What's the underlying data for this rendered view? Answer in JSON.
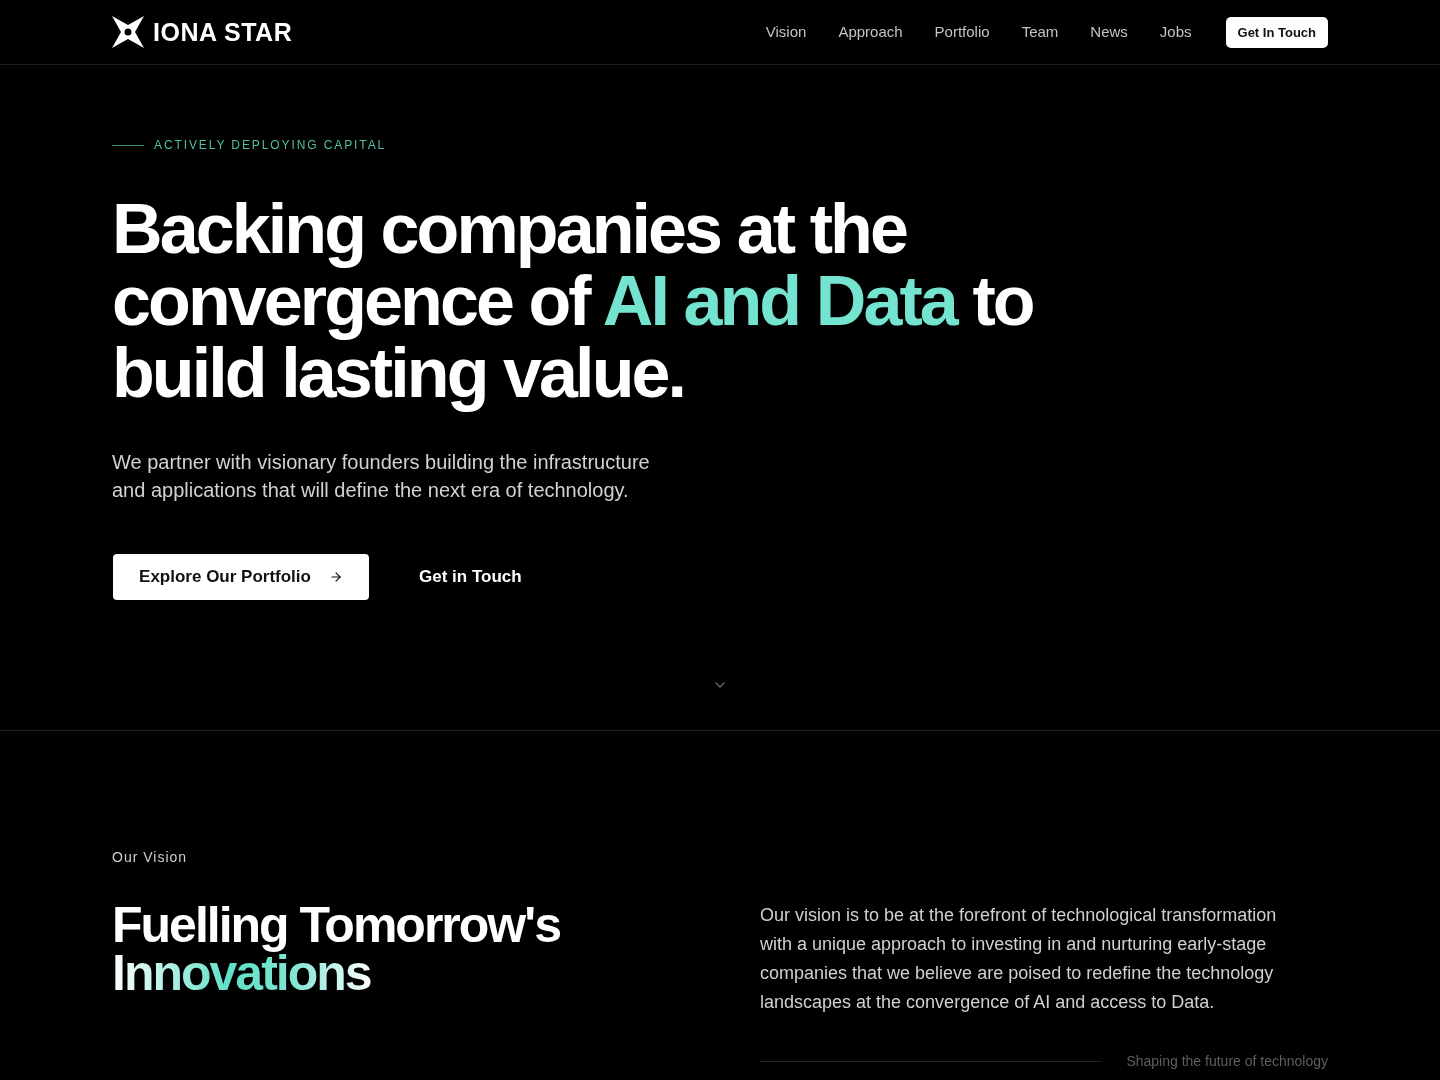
{
  "header": {
    "logo": "IONA STAR",
    "nav_links": [
      "Vision",
      "Approach",
      "Portfolio",
      "Team",
      "News",
      "Jobs"
    ],
    "cta": "Get In Touch"
  },
  "hero": {
    "eyebrow": "ACTIVELY DEPLOYING CAPITAL",
    "headline": [
      {
        "text": "Backing companies at the convergence of ",
        "accent": false
      },
      {
        "text": "AI and Data",
        "accent": true
      },
      {
        "text": " to build lasting value.",
        "accent": false
      }
    ],
    "description": "We partner with visionary founders building the infrastructure and applications that will define the next era of technology.",
    "primary_button": "Explore Our Portfolio",
    "secondary_button": "Get in Touch"
  },
  "vision": {
    "eyebrow": "Our Vision",
    "title": [
      {
        "text": "Fuelling Tomorrow's ",
        "accent": false
      },
      {
        "text": "Innovations",
        "accent": true
      }
    ],
    "body": "Our vision is to be at the forefront of technological transformation with a unique approach to investing in and nurturing early-stage companies that we believe are poised to redefine the technology landscapes at the convergence of AI and access to Data.",
    "caption": "Shaping the future of technology"
  }
}
